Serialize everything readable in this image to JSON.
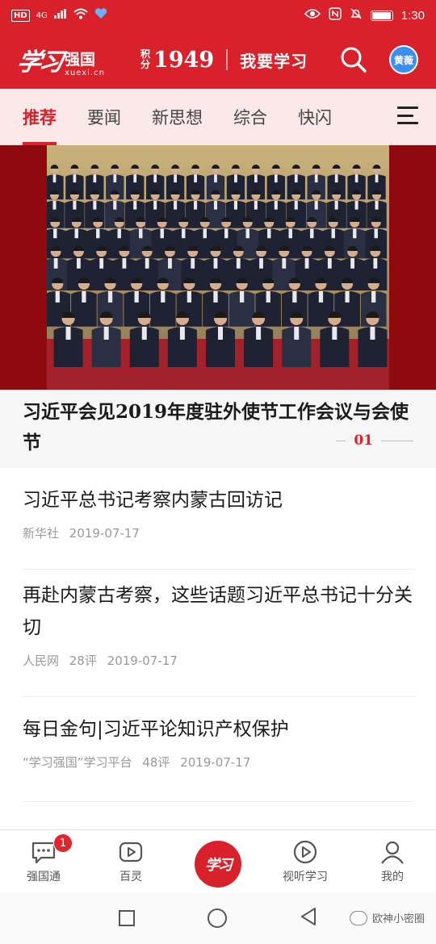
{
  "status_bar": {
    "network_badge": "HD",
    "signal": "4G",
    "time": "1:30"
  },
  "header": {
    "logo_script": "学习",
    "logo_name": "强国",
    "logo_domain": "xuexi.cn",
    "points_label_top": "积",
    "points_label_bottom": "分",
    "points_value": "1949",
    "study_label": "我要学习",
    "avatar_text": "黄薇"
  },
  "tabs": [
    {
      "label": "推荐",
      "active": true
    },
    {
      "label": "要闻"
    },
    {
      "label": "新思想"
    },
    {
      "label": "综合"
    },
    {
      "label": "快闪"
    }
  ],
  "hero": {
    "title": "习近平会见2019年度驻外使节工作会议与会使节",
    "index": "01"
  },
  "news": [
    {
      "title": "习近平总书记考察内蒙古回访记",
      "source": "新华社",
      "comments": "",
      "date": "2019-07-17"
    },
    {
      "title": "再赴内蒙古考察，这些话题习近平总书记十分关切",
      "source": "人民网",
      "comments": "28评",
      "date": "2019-07-17"
    },
    {
      "title": "每日金句|习近平论知识产权保护",
      "source": "“学习强国”学习平台",
      "comments": "48评",
      "date": "2019-07-17"
    }
  ],
  "bottom_nav": {
    "items": [
      {
        "label": "强国通",
        "icon": "chat-icon",
        "badge": "1"
      },
      {
        "label": "百灵",
        "icon": "video-icon"
      },
      {
        "label": "",
        "icon": "xuexi-logo",
        "logo_text": "学习"
      },
      {
        "label": "视听学习",
        "icon": "play-icon"
      },
      {
        "label": "我的",
        "icon": "user-icon"
      }
    ]
  },
  "watermark": "欧神小密圈",
  "colors": {
    "brand_red": "#d8212b",
    "tab_bg": "#fbe9ea",
    "avatar_blue": "#3a8ff0"
  }
}
